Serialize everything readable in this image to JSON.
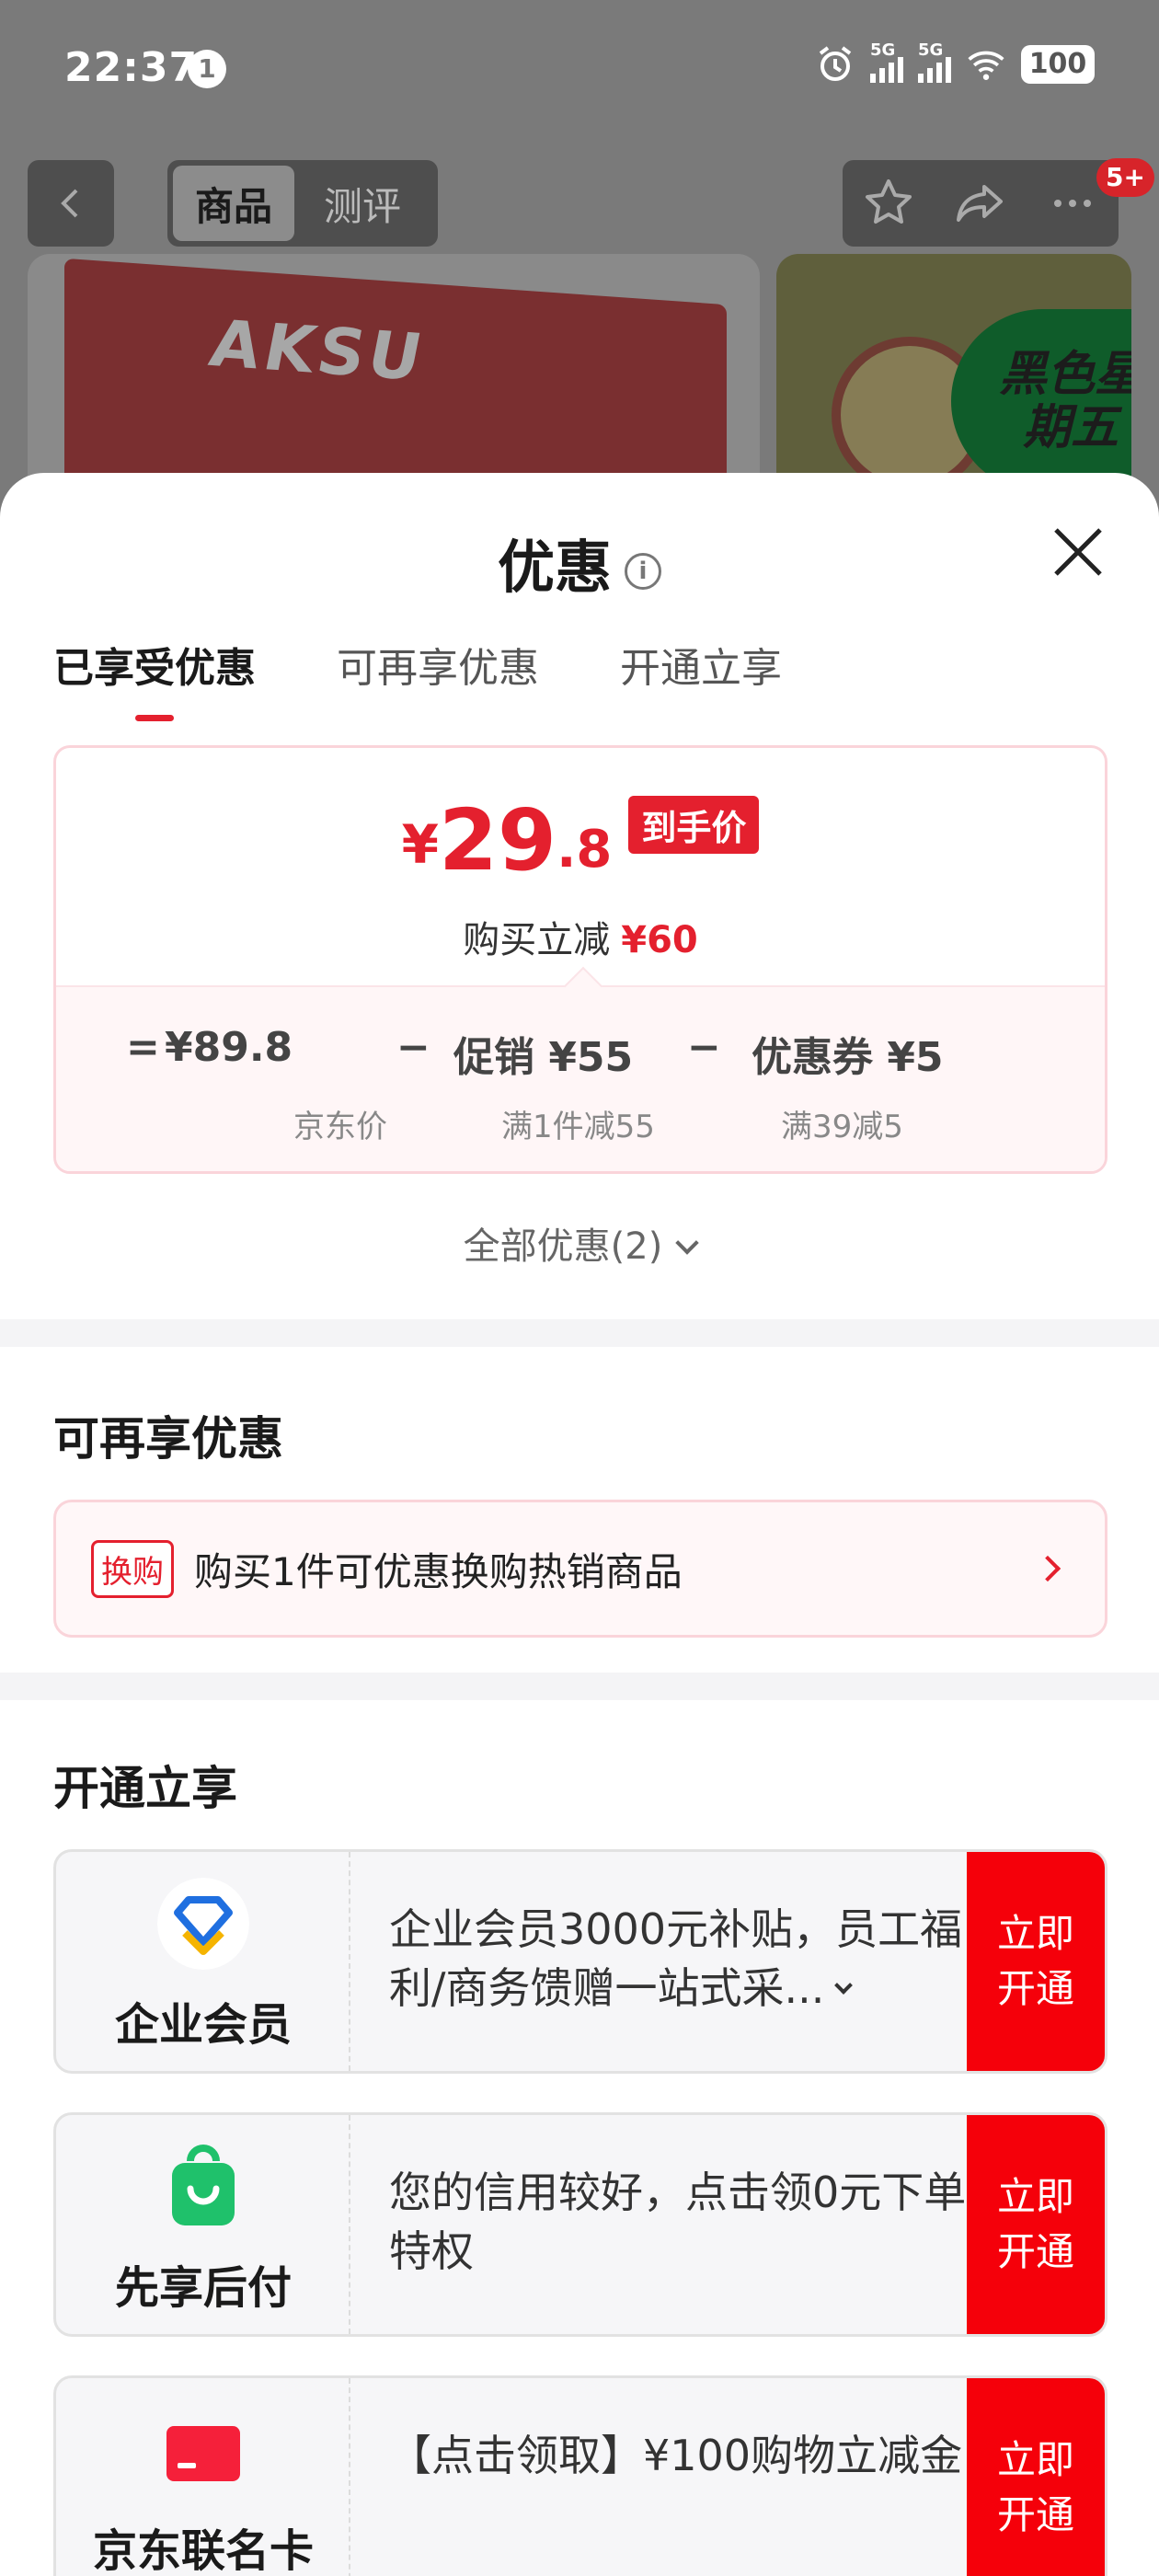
{
  "status_bar": {
    "time": "22:37",
    "notification_count": "1",
    "network_1": "5G",
    "network_2": "5G",
    "battery": "100"
  },
  "nav": {
    "tabs": [
      "商品",
      "测评"
    ],
    "badge": "5+"
  },
  "background": {
    "product_brand": "AKSU",
    "promo_banner": "黑色星期五"
  },
  "sheet": {
    "title": "优惠",
    "tabs": [
      "已享受优惠",
      "可再享优惠",
      "开通立享"
    ],
    "price": {
      "currency": "¥",
      "integer": "29",
      "decimal": ".8",
      "tag": "到手价",
      "reduce_label": "购买立减",
      "reduce_amount": "¥60"
    },
    "formula": {
      "eq": "=",
      "jd_price": "¥89.8",
      "minus1": "−",
      "promo": "促销 ¥55",
      "minus2": "−",
      "coupon": "优惠券 ¥5",
      "jd_price_label": "京东价",
      "promo_label": "满1件减55",
      "coupon_label": "满39减5"
    },
    "all_offers": "全部优惠(2)",
    "more_section": {
      "title": "可再享优惠",
      "swap_label": "换购",
      "swap_text": "购买1件可优惠换购热销商品"
    },
    "open_section": {
      "title": "开通立享",
      "items": [
        {
          "name": "企业会员",
          "desc": "企业会员3000元补贴，员工福利/商务馈赠一站式采...",
          "button": "立即开通"
        },
        {
          "name": "先享后付",
          "desc": "您的信用较好，点击领0元下单特权",
          "button": "立即开通"
        },
        {
          "name": "京东联名卡",
          "desc": "【点击领取】¥100购物立减金",
          "button": "立即开通"
        }
      ]
    }
  },
  "colors": {
    "accent": "#e4202e",
    "button": "#f5000a",
    "green": "#1fc16b"
  }
}
